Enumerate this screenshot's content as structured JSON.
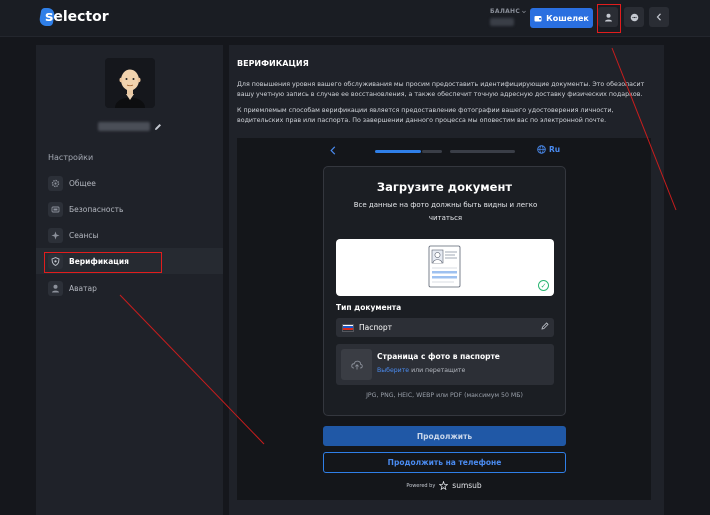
{
  "header": {
    "logo_text": "selector",
    "balance_label": "БАЛАНС",
    "wallet_button": "Кошелек",
    "profile_icon": "user-icon",
    "chat_icon": "chat-icon",
    "collapse_icon": "chevron-left-icon"
  },
  "sidebar": {
    "settings_title": "Настройки",
    "items": [
      {
        "label": "Общее",
        "icon": "gear-icon"
      },
      {
        "label": "Безопасность",
        "icon": "shield-icon"
      },
      {
        "label": "Сеансы",
        "icon": "sessions-icon"
      },
      {
        "label": "Верификация",
        "icon": "verification-icon",
        "active": true
      },
      {
        "label": "Аватар",
        "icon": "user-icon"
      }
    ]
  },
  "main": {
    "title": "ВЕРИФИКАЦИЯ",
    "paragraph1": "Для повышения уровня вашего обслуживания мы просим предоставить идентифицирующие документы. Это обезопасит вашу учетную запись в случае ее восстановления, а также обеспечит точную адресную доставку физических подарков.",
    "paragraph2": "К приемлемым способам верификации является предоставление фотографии вашего удостоверения личности, водительских прав или паспорта. По завершении данного процесса мы оповестим вас по электронной почте."
  },
  "widget": {
    "language": "Ru",
    "card_title": "Загрузите документ",
    "card_subtitle": "Все данные на фото должны быть видны и легко читаться",
    "doc_type_label": "Тип документа",
    "doc_type_value": "Паспорт",
    "upload_title": "Страница с фото в паспорте",
    "upload_link": "Выберите",
    "upload_rest": " или перетащите",
    "formats": "JPG, PNG, HEIC, WEBP или PDF (максимум 50 МБ)",
    "continue_button": "Продолжить",
    "phone_button": "Продолжить на телефоне",
    "powered_by": "Powered by",
    "brand": "sumsub"
  },
  "colors": {
    "accent": "#2a6fe0",
    "annotation": "#e11d1d",
    "background": "#15171c",
    "panel": "#1f2229"
  }
}
